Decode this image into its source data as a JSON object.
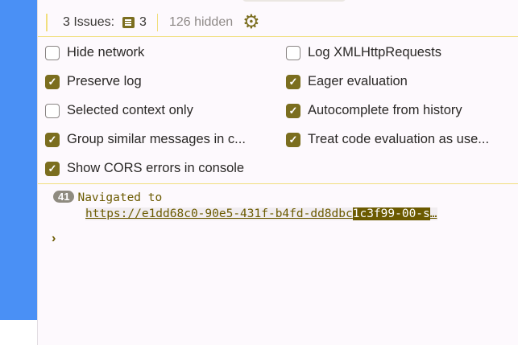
{
  "toolbar": {
    "issues_label": "3 Issues:",
    "issues_count": "3",
    "hidden_label": "126 hidden"
  },
  "settings": [
    {
      "label": "Hide network",
      "checked": false
    },
    {
      "label": "Log XMLHttpRequests",
      "checked": false
    },
    {
      "label": "Preserve log",
      "checked": true
    },
    {
      "label": "Eager evaluation",
      "checked": true
    },
    {
      "label": "Selected context only",
      "checked": false
    },
    {
      "label": "Autocomplete from history",
      "checked": true
    },
    {
      "label": "Group similar messages in c...",
      "checked": true
    },
    {
      "label": "Treat code evaluation as use...",
      "checked": true
    },
    {
      "label": "Show CORS errors in console",
      "checked": true
    }
  ],
  "console": {
    "repeat_count": "41",
    "message": "Navigated to",
    "url_plain": "https://e1dd68c0-90e5-431f-b4fd-dd8dbc",
    "url_highlight": "1c3f99-00-s",
    "url_ellipsis": "…",
    "prompt": "›"
  },
  "colors": {
    "accent": "#7b6e1f",
    "border": "#f1df7e",
    "sidebar": "#4a90f5"
  }
}
